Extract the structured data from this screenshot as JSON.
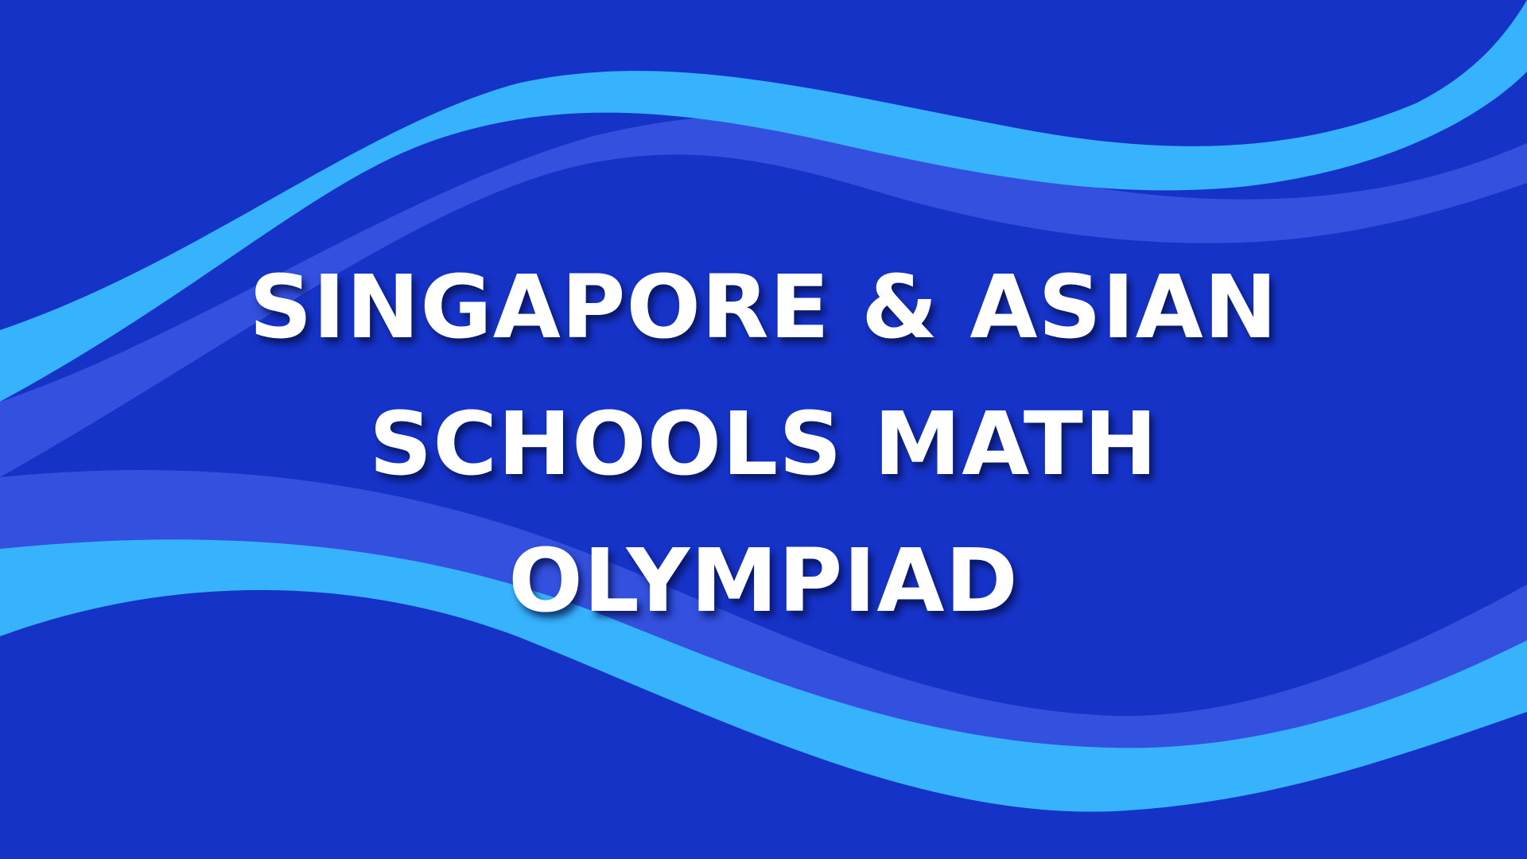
{
  "colors": {
    "background": "#1633c8",
    "wave_light": "#36b3fc",
    "wave_mid": "#3350de",
    "text": "#ffffff"
  },
  "title": {
    "lines": [
      "SINGAPORE & ASIAN",
      "SCHOOLS MATH",
      "OLYMPIAD"
    ]
  }
}
